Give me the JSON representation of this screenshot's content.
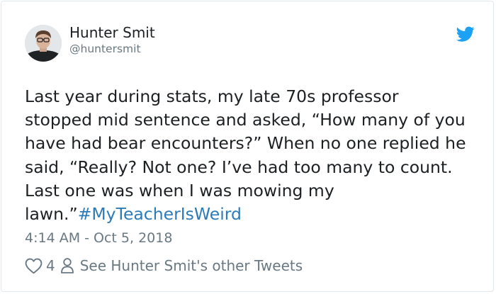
{
  "author": {
    "name": "Hunter Smit",
    "handle": "@huntersmit",
    "avatar_icon": "avatar-photo"
  },
  "brand": {
    "icon": "twitter-bird-icon",
    "color": "#1da1f2"
  },
  "tweet": {
    "lines": [
      "Last year during stats, my late 70s professor",
      "stopped mid sentence and asked, “How many of you",
      "have had bear encounters?” When no one replied he",
      "said, “Really? Not one? I’ve had too many to count.",
      "Last one was when I was mowing my"
    ],
    "last_line_prefix": "lawn.”",
    "hashtag": "#MyTeacherIsWeird",
    "hashtag_color": "#2b7bb9",
    "timestamp": "4:14 AM - Oct 5, 2018"
  },
  "actions": {
    "like_icon": "heart-icon",
    "like_count": "4",
    "profile_icon": "person-icon",
    "see_more_label": "See Hunter Smit's other Tweets"
  }
}
